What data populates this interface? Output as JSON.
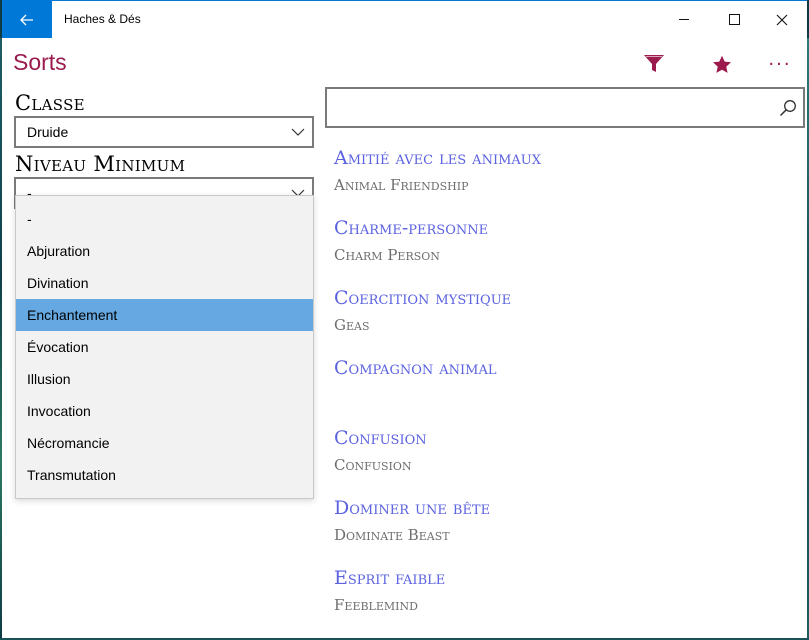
{
  "window": {
    "app_title": "Haches & Dés",
    "back_icon": "back-arrow-icon",
    "minimize_icon": "minimize-icon",
    "maximize_icon": "maximize-icon",
    "close_icon": "close-icon"
  },
  "header": {
    "title": "Sorts",
    "accent_color": "#9b1b4e",
    "commands": [
      "filter-icon",
      "star-icon",
      "more-icon"
    ],
    "more_label": "···"
  },
  "filters": {
    "classe_label": "Classe",
    "classe_value": "Druide",
    "niveau_label": "Niveau Minimum",
    "niveau_value": "-",
    "dropdown_options": [
      "-",
      "Abjuration",
      "Divination",
      "Enchantement",
      "Évocation",
      "Illusion",
      "Invocation",
      "Nécromancie",
      "Transmutation"
    ],
    "dropdown_selected": "Enchantement",
    "selected_color": "#65a8e2"
  },
  "search": {
    "value": "",
    "icon": "search-icon"
  },
  "spells": [
    {
      "name": "Amitié avec les animaux",
      "english": "Animal Friendship"
    },
    {
      "name": "Charme-personne",
      "english": "Charm Person"
    },
    {
      "name": "Coercition mystique",
      "english": "Geas"
    },
    {
      "name": "Compagnon animal",
      "english": ""
    },
    {
      "name": "Confusion",
      "english": "Confusion"
    },
    {
      "name": "Dominer une bête",
      "english": "Dominate Beast"
    },
    {
      "name": "Esprit faible",
      "english": "Feeblemind"
    }
  ],
  "colors": {
    "spell_name": "#5b62e0",
    "spell_english": "#6e6e6e",
    "titlebar_accent": "#0078d7"
  }
}
